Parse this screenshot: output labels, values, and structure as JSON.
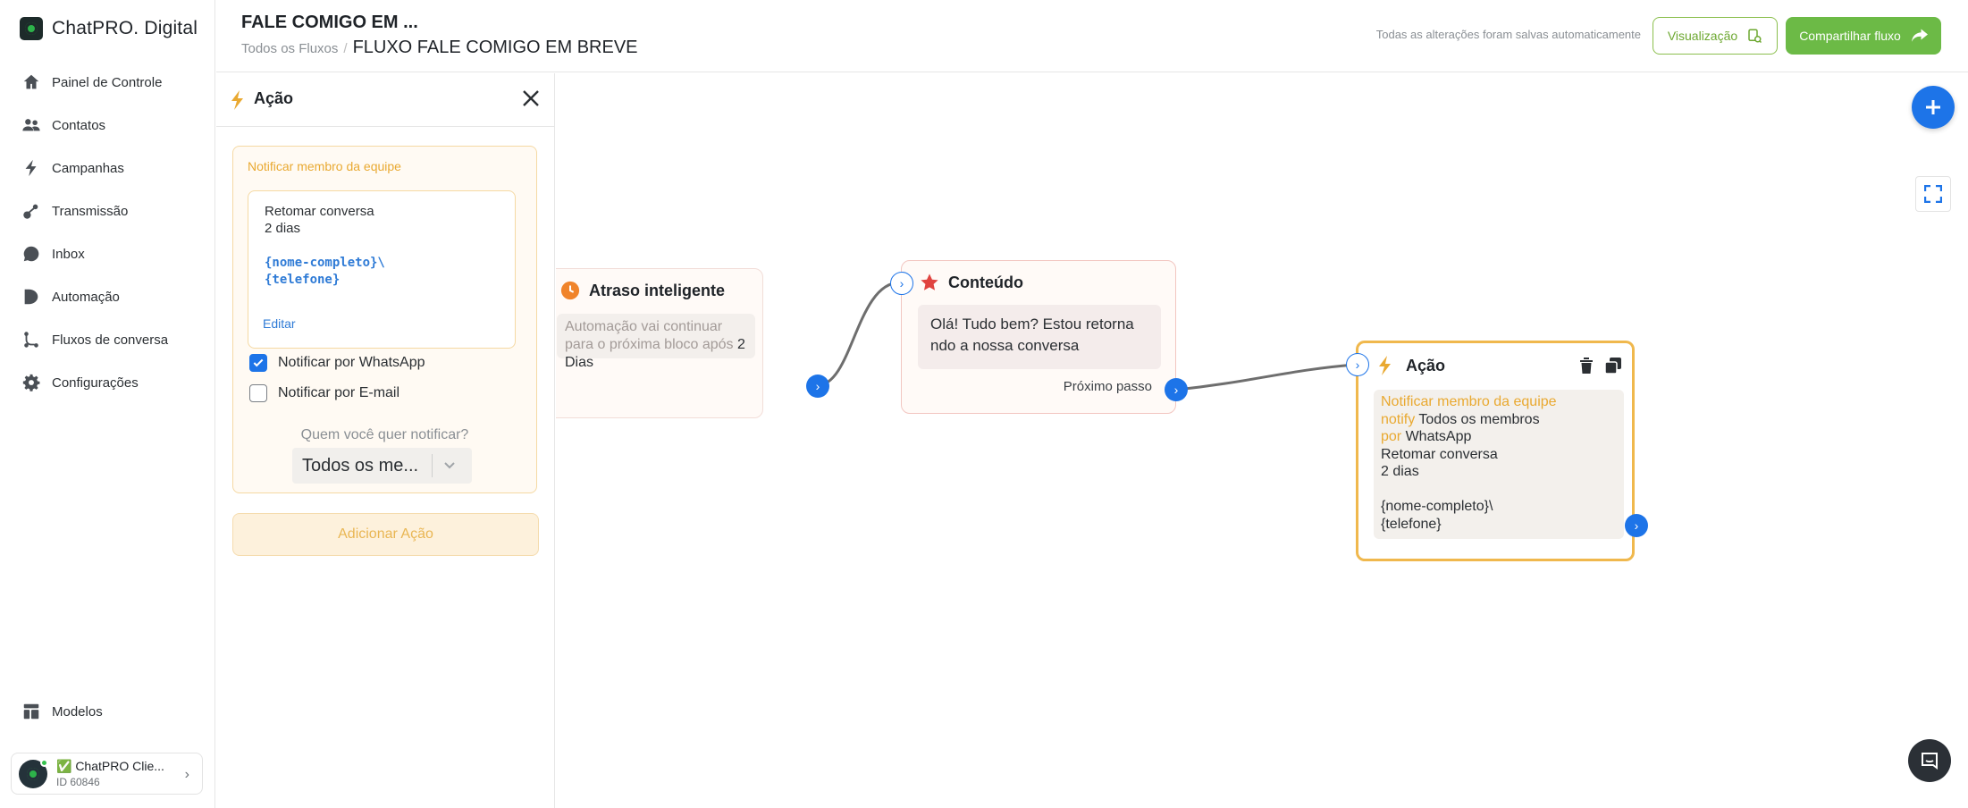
{
  "brand": {
    "name": "ChatPRO. Digital"
  },
  "sidebar": {
    "items": [
      {
        "label": "Painel de Controle",
        "icon": "home-icon"
      },
      {
        "label": "Contatos",
        "icon": "users-icon"
      },
      {
        "label": "Campanhas",
        "icon": "bolt-icon"
      },
      {
        "label": "Transmissão",
        "icon": "broadcast-icon"
      },
      {
        "label": "Inbox",
        "icon": "chat-bubble-icon"
      },
      {
        "label": "Automação",
        "icon": "play-icon"
      },
      {
        "label": "Fluxos de conversa",
        "icon": "flow-icon"
      },
      {
        "label": "Configurações",
        "icon": "gear-icon"
      }
    ],
    "templates_label": "Modelos",
    "account": {
      "name": "✅ ChatPRO Clie...",
      "id": "ID 60846"
    }
  },
  "header": {
    "title": "FALE COMIGO EM ...",
    "breadcrumb_root": "Todos os Fluxos",
    "breadcrumb_sep": "/",
    "breadcrumb_current": "FLUXO FALE COMIGO EM BREVE",
    "autosave": "Todas as alterações foram salvas automaticamente",
    "preview_label": "Visualização",
    "share_label": "Compartilhar fluxo"
  },
  "panel": {
    "title": "Ação",
    "card_label": "Notificar membro da equipe",
    "message_line1": "Retomar conversa",
    "message_line2": "2 dias",
    "var_line1": "{nome-completo}\\",
    "var_line2": "{telefone}",
    "edit_label": "Editar",
    "whatsapp_label": "Notificar por WhatsApp",
    "whatsapp_checked": true,
    "email_label": "Notificar por E-mail",
    "email_checked": false,
    "who_label": "Quem você quer notificar?",
    "who_value": "Todos os me...",
    "add_action_label": "Adicionar Ação"
  },
  "canvas": {
    "delay_node": {
      "title": "Atraso inteligente",
      "body_prefix": "Automação vai continuar para o próxima bloco após",
      "body_value": "2 Dias"
    },
    "content_node": {
      "title": "Conteúdo",
      "message": "Olá! Tudo bem? Estou retorna ndo a nossa conversa",
      "next_step": "Próximo passo"
    },
    "action_node": {
      "title": "Ação",
      "card_label": "Notificar membro da equipe",
      "notify_word": "notify",
      "notify_target": "Todos os membros",
      "by_word": "por",
      "by_channel": "WhatsApp",
      "line1": "Retomar conversa",
      "line2": "2 dias",
      "var1": "{nome-completo}\\",
      "var2": "{telefone}"
    }
  },
  "colors": {
    "primary_blue": "#1d74e8",
    "green": "#6cba46",
    "accent_orange": "#e9a931"
  }
}
